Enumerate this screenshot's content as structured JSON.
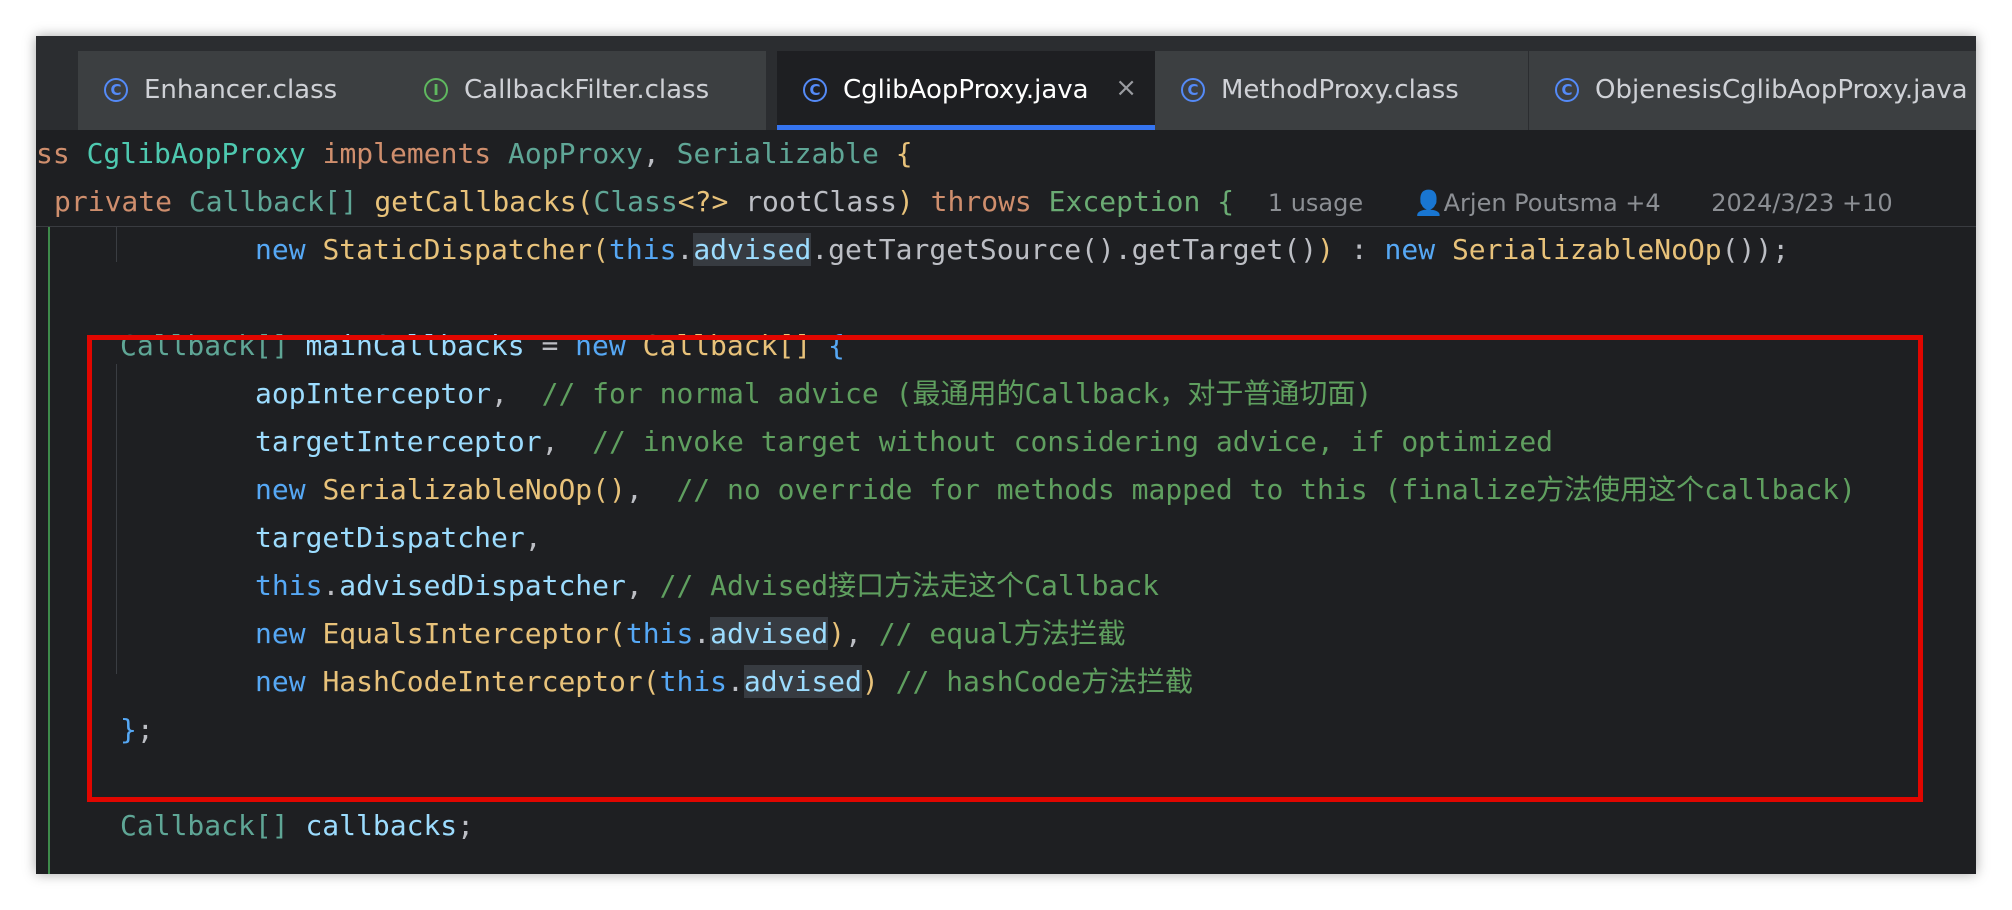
{
  "tabs": [
    {
      "icon": "class-icon",
      "glyph": "C",
      "label": "Enhancer.class"
    },
    {
      "icon": "interface-icon",
      "glyph": "I",
      "label": "CallbackFilter.class"
    },
    {
      "icon": "class-icon",
      "glyph": "C",
      "label": "CglibAopProxy.java",
      "close": "×"
    },
    {
      "icon": "class-icon",
      "glyph": "C",
      "label": "MethodProxy.class"
    },
    {
      "icon": "class-icon",
      "glyph": "C",
      "label": "ObjenesisCglibAopProxy.java"
    }
  ],
  "sticky": {
    "line1": {
      "kw1": "ss",
      "cls": "CglibAopProxy",
      "kw2": "implements",
      "t1": "AopProxy",
      "comma": ",",
      "t2": "Serializable",
      "brace": "{"
    },
    "line2": {
      "kw1": "private",
      "t1": "Callback[]",
      "m": "getCallbacks",
      "p1": "(",
      "t2": "Class",
      "gen": "<?>",
      "arg": "rootClass",
      "p2": ")",
      "kw2": "throws",
      "t3": "Exception",
      "brace": "{",
      "usage": "1 usage",
      "author": "Arjen Poutsma +4",
      "date": "2024/3/23 +10"
    }
  },
  "code": {
    "line_a": {
      "kw": "new",
      "t": "StaticDispatcher",
      "p": "(",
      "this": "this",
      "dot1": ".",
      "f": "advised",
      "rest": ".getTargetSource().getTarget()",
      "p2": ")",
      "colon": " : ",
      "kw2": "new",
      "t2": "SerializableNoOp",
      "tail": "());"
    },
    "line_b": {
      "t": "Callback[]",
      "v": "mainCallbacks",
      "eq": " = ",
      "kw": "new",
      "t2": "Callback[]",
      "brace": "{"
    },
    "line_c": {
      "id": "aopInterceptor",
      "comma": ",",
      "cm": "// for normal advice (最通用的Callback，对于普通切面)"
    },
    "line_d": {
      "id": "targetInterceptor",
      "comma": ",",
      "cm": "// invoke target without considering advice, if optimized"
    },
    "line_e": {
      "kw": "new",
      "t": "SerializableNoOp",
      "paren": "()",
      "comma": ",",
      "cm": "// no override for methods mapped to this (finalize方法使用这个callback)"
    },
    "line_f": {
      "id": "targetDispatcher",
      "comma": ","
    },
    "line_g": {
      "this": "this",
      "dot": ".",
      "id": "advisedDispatcher",
      "comma": ",",
      "cm": "// Advised接口方法走这个Callback"
    },
    "line_h": {
      "kw": "new",
      "t": "EqualsInterceptor",
      "p1": "(",
      "this": "this",
      "dot": ".",
      "f": "advised",
      "p2": ")",
      "comma": ",",
      "cm": "// equal方法拦截"
    },
    "line_i": {
      "kw": "new",
      "t": "HashCodeInterceptor",
      "p1": "(",
      "this": "this",
      "dot": ".",
      "f": "advised",
      "p2": ")",
      "cm": "// hashCode方法拦截"
    },
    "line_j": {
      "brace": "}",
      "semi": ";"
    },
    "line_k": {
      "t": "Callback[]",
      "v": "callbacks",
      "semi": ";"
    }
  },
  "colors": {
    "accent": "#3574f0",
    "highlight_box": "#e10600",
    "background": "#1e1f22"
  }
}
